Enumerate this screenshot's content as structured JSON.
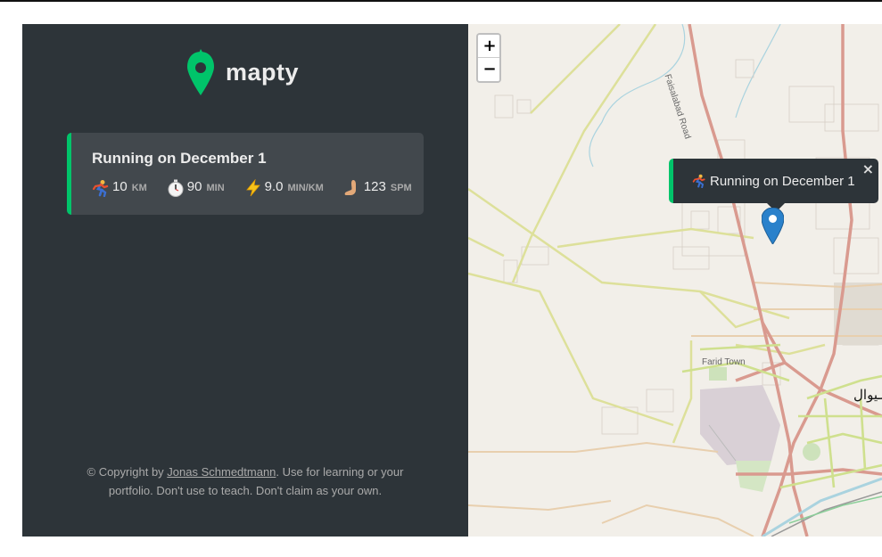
{
  "app": {
    "name": "mapty",
    "brand_color": "#00c46a",
    "sidebar_color": "#2d3439"
  },
  "workouts": [
    {
      "type": "running",
      "title": "Running on December 1",
      "details": [
        {
          "icon": "running-icon",
          "value": "10",
          "unit": "km"
        },
        {
          "icon": "stopwatch-icon",
          "value": "90",
          "unit": "min"
        },
        {
          "icon": "lightning-icon",
          "value": "9.0",
          "unit": "min/km"
        },
        {
          "icon": "footprint-icon",
          "value": "123",
          "unit": "spm"
        }
      ]
    }
  ],
  "footer": {
    "prefix": "© Copyright by ",
    "author": "Jonas Schmedtmann",
    "suffix": ". Use for learning or your portfolio. Don't use to teach. Don't claim as your own."
  },
  "map": {
    "zoom_in": "+",
    "zoom_out": "−",
    "popup": {
      "text": "Running on December 1",
      "close": "×"
    },
    "labels": {
      "road": "Faisalabad Road",
      "town": "Farid Town",
      "urdu": "ساہیوال"
    }
  }
}
